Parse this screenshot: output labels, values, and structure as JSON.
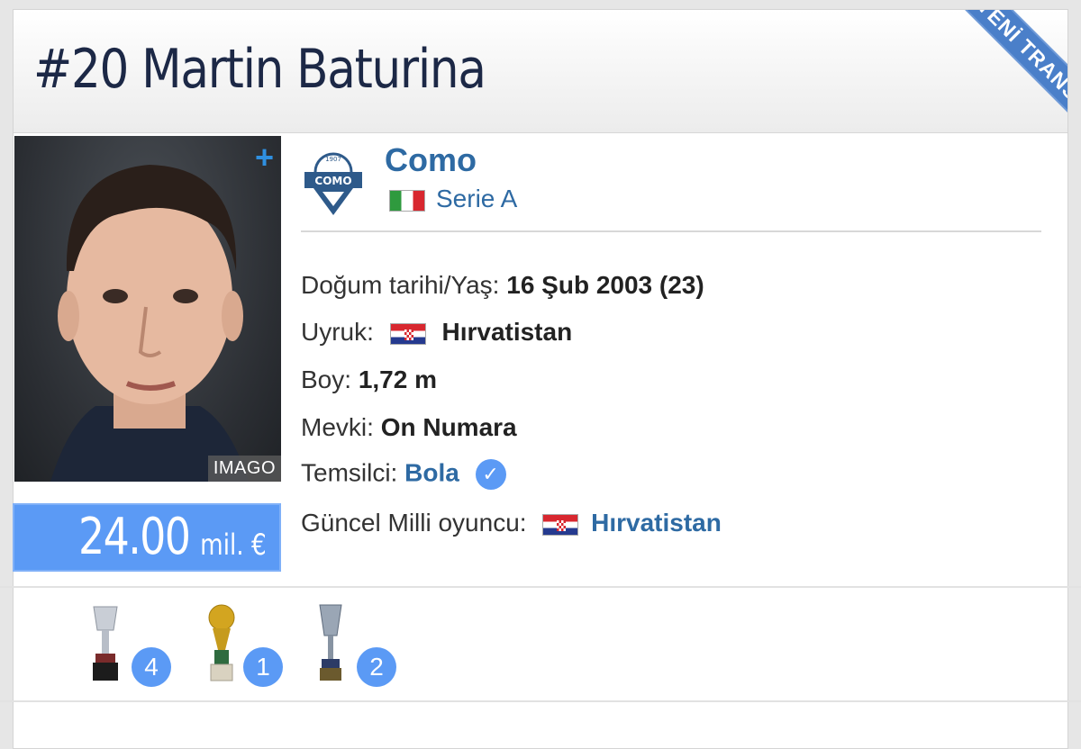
{
  "header": {
    "title": "#20 Martin Baturina",
    "ribbon": "YENİ TRANSFER"
  },
  "photo": {
    "credit": "IMAGO"
  },
  "market_value": {
    "amount": "24.00",
    "unit": "mil. €"
  },
  "club": {
    "name": "Como",
    "league": "Serie A",
    "logo_text": "COMO",
    "logo_year": "1907"
  },
  "details": {
    "dob_label": "Doğum tarihi/Yaş:",
    "dob_value": "16 Şub 2003 (23)",
    "nationality_label": "Uyruk:",
    "nationality_value": "Hırvatistan",
    "height_label": "Boy:",
    "height_value": "1,72 m",
    "position_label": "Mevki:",
    "position_value": "On Numara",
    "agent_label": "Temsilci:",
    "agent_value": "Bola",
    "national_label": "Güncel Milli oyuncu:",
    "national_value": "Hırvatistan"
  },
  "trophies": [
    {
      "icon": "trophy-icon",
      "count": "4"
    },
    {
      "icon": "golden-ball-trophy-icon",
      "count": "1"
    },
    {
      "icon": "cup-trophy-icon",
      "count": "2"
    }
  ]
}
